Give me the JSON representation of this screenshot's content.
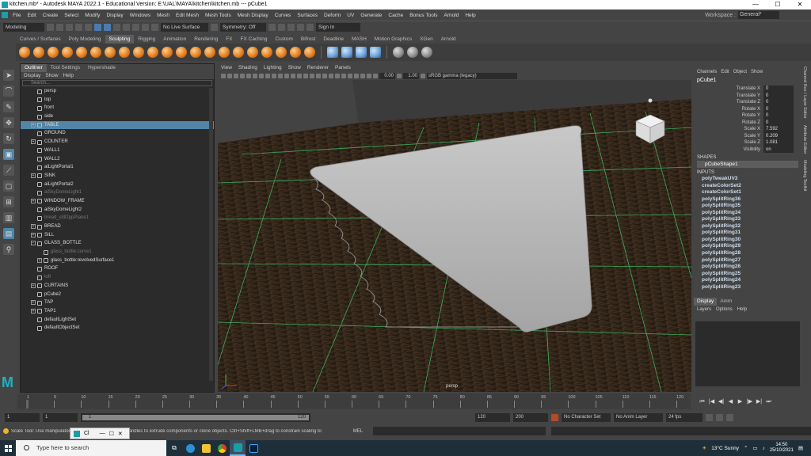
{
  "window": {
    "title": "kitchen.mb* - Autodesk MAYA 2022.1 - Educational Version: E:\\UAL\\MAYA\\kitchen\\kitchen.mb   ---   pCube1"
  },
  "menubar": {
    "items": [
      "File",
      "Edit",
      "Create",
      "Select",
      "Modify",
      "Display",
      "Windows",
      "Mesh",
      "Edit Mesh",
      "Mesh Tools",
      "Mesh Display",
      "Curves",
      "Surfaces",
      "Deform",
      "UV",
      "Generate",
      "Cache",
      "Bonus Tools",
      "Arnold",
      "Help"
    ],
    "workspace_label": "Workspace :",
    "workspace_value": "General*"
  },
  "statusline": {
    "mode": "Modeling",
    "live_surface": "No Live Surface",
    "symmetry": "Symmetry: Off",
    "sign_in": "Sign In"
  },
  "shelf": {
    "tabs": [
      "Curves / Surfaces",
      "Poly Modeling",
      "Sculpting",
      "Rigging",
      "Animation",
      "Rendering",
      "FX",
      "FX Caching",
      "Custom",
      "Bifrost",
      "Deadline",
      "MASH",
      "Motion Graphics",
      "XGen",
      "Arnold"
    ],
    "active_tab": "Sculpting"
  },
  "outliner": {
    "tabs": [
      "Outliner",
      "Tool Settings",
      "Hypershade"
    ],
    "menu": [
      "Display",
      "Show",
      "Help"
    ],
    "search_placeholder": "Search...",
    "items": [
      {
        "label": "persp",
        "expand": "",
        "dim": false,
        "sel": false,
        "indent": 0
      },
      {
        "label": "top",
        "expand": "",
        "dim": false,
        "sel": false,
        "indent": 0
      },
      {
        "label": "front",
        "expand": "",
        "dim": false,
        "sel": false,
        "indent": 0
      },
      {
        "label": "side",
        "expand": "",
        "dim": false,
        "sel": false,
        "indent": 0
      },
      {
        "label": "TABLE",
        "expand": "+",
        "dim": false,
        "sel": true,
        "indent": 0
      },
      {
        "label": "GROUND",
        "expand": "",
        "dim": false,
        "sel": false,
        "indent": 0
      },
      {
        "label": "COUNTER",
        "expand": "+",
        "dim": false,
        "sel": false,
        "indent": 0
      },
      {
        "label": "WALL1",
        "expand": "",
        "dim": false,
        "sel": false,
        "indent": 0
      },
      {
        "label": "WALL2",
        "expand": "",
        "dim": false,
        "sel": false,
        "indent": 0
      },
      {
        "label": "aiLightPortal1",
        "expand": "",
        "dim": false,
        "sel": false,
        "indent": 0
      },
      {
        "label": "SINK",
        "expand": "+",
        "dim": false,
        "sel": false,
        "indent": 0
      },
      {
        "label": "aiLightPortal2",
        "expand": "",
        "dim": false,
        "sel": false,
        "indent": 0
      },
      {
        "label": "aiSkyDomeLight1",
        "expand": "",
        "dim": true,
        "sel": false,
        "indent": 0
      },
      {
        "label": "WINDOW_FRAME",
        "expand": "+",
        "dim": false,
        "sel": false,
        "indent": 0
      },
      {
        "label": "aiSkyDomeLight2",
        "expand": "",
        "dim": false,
        "sel": false,
        "indent": 0
      },
      {
        "label": "bread_still2ppPlane1",
        "expand": "",
        "dim": true,
        "sel": false,
        "indent": 0
      },
      {
        "label": "BREAD",
        "expand": "+",
        "dim": false,
        "sel": false,
        "indent": 0
      },
      {
        "label": "SILL",
        "expand": "+",
        "dim": false,
        "sel": false,
        "indent": 0
      },
      {
        "label": "GLASS_BOTTLE",
        "expand": "−",
        "dim": false,
        "sel": false,
        "indent": 0
      },
      {
        "label": "glass_bottle:curve1",
        "expand": "",
        "dim": true,
        "sel": false,
        "indent": 1
      },
      {
        "label": "glass_bottle:revolvedSurface1",
        "expand": "+",
        "dim": false,
        "sel": false,
        "indent": 1
      },
      {
        "label": "ROOF",
        "expand": "",
        "dim": false,
        "sel": false,
        "indent": 0
      },
      {
        "label": "loft",
        "expand": "",
        "dim": true,
        "sel": false,
        "indent": 0
      },
      {
        "label": "CURTAINS",
        "expand": "+",
        "dim": false,
        "sel": false,
        "indent": 0
      },
      {
        "label": "pCube2",
        "expand": "",
        "dim": false,
        "sel": false,
        "indent": 0
      },
      {
        "label": "TAP",
        "expand": "+",
        "dim": false,
        "sel": false,
        "indent": 0
      },
      {
        "label": "TAP1",
        "expand": "+",
        "dim": false,
        "sel": false,
        "indent": 0
      },
      {
        "label": "defaultLightSet",
        "expand": "",
        "dim": false,
        "sel": false,
        "indent": 0
      },
      {
        "label": "defaultObjectSet",
        "expand": "",
        "dim": false,
        "sel": false,
        "indent": 0
      }
    ]
  },
  "viewport": {
    "menu": [
      "View",
      "Shading",
      "Lighting",
      "Show",
      "Renderer",
      "Panels"
    ],
    "exposure": "0.00",
    "gamma": "1.00",
    "color_space": "sRGB gamma (legacy)",
    "camera_label": "persp"
  },
  "channelbox": {
    "menu": [
      "Channels",
      "Edit",
      "Object",
      "Show"
    ],
    "object": "pCube1",
    "channels": [
      {
        "label": "Translate X",
        "value": "0"
      },
      {
        "label": "Translate Y",
        "value": "0"
      },
      {
        "label": "Translate Z",
        "value": "0"
      },
      {
        "label": "Rotate X",
        "value": "0"
      },
      {
        "label": "Rotate Y",
        "value": "0"
      },
      {
        "label": "Rotate Z",
        "value": "0"
      },
      {
        "label": "Scale X",
        "value": "7.592"
      },
      {
        "label": "Scale Y",
        "value": "0.209"
      },
      {
        "label": "Scale Z",
        "value": "1.081"
      },
      {
        "label": "Visibility",
        "value": "on"
      }
    ],
    "shapes_heading": "SHAPES",
    "shape": "pCubeShape1",
    "inputs_heading": "INPUTS",
    "inputs": [
      "polyTweakUV3",
      "createColorSet2",
      "createColorSet1",
      "polySplitRing36",
      "polySplitRing35",
      "polySplitRing34",
      "polySplitRing33",
      "polySplitRing32",
      "polySplitRing31",
      "polySplitRing30",
      "polySplitRing29",
      "polySplitRing28",
      "polySplitRing27",
      "polySplitRing26",
      "polySplitRing25",
      "polySplitRing24",
      "polySplitRing23"
    ],
    "side_tabs": [
      "Channel Box / Layer Editor",
      "Attribute Editor",
      "Modeling Toolkit"
    ]
  },
  "layers": {
    "tabs": [
      "Display",
      "Anim"
    ],
    "menu": [
      "Layers",
      "Options",
      "Help"
    ]
  },
  "timeslider": {
    "ticks": [
      "1",
      "5",
      "10",
      "15",
      "20",
      "25",
      "30",
      "35",
      "40",
      "45",
      "50",
      "55",
      "60",
      "65",
      "70",
      "75",
      "80",
      "85",
      "90",
      "95",
      "100",
      "105",
      "110",
      "115",
      "120"
    ],
    "current_frame": "1"
  },
  "rangebar": {
    "start": "1",
    "start2": "1",
    "range_start": "1",
    "range_end": "120",
    "end": "120",
    "end2": "200",
    "character_set": "No Character Set",
    "anim_layer": "No Anim Layer",
    "fps": "24 fps"
  },
  "cmdline": {
    "help_text": "Scale Tool: Use manipulator to [...] ulator axis or plane handles to extrude components or clone objects. Ctrl+Shift+LMB+drag to constrain scaling to",
    "mel_label": "MEL"
  },
  "popup": {
    "label": "Cl"
  },
  "taskbar": {
    "search_placeholder": "Type here to search",
    "weather": "13°C  Sunny",
    "time": "14:50",
    "date": "25/10/2021"
  }
}
